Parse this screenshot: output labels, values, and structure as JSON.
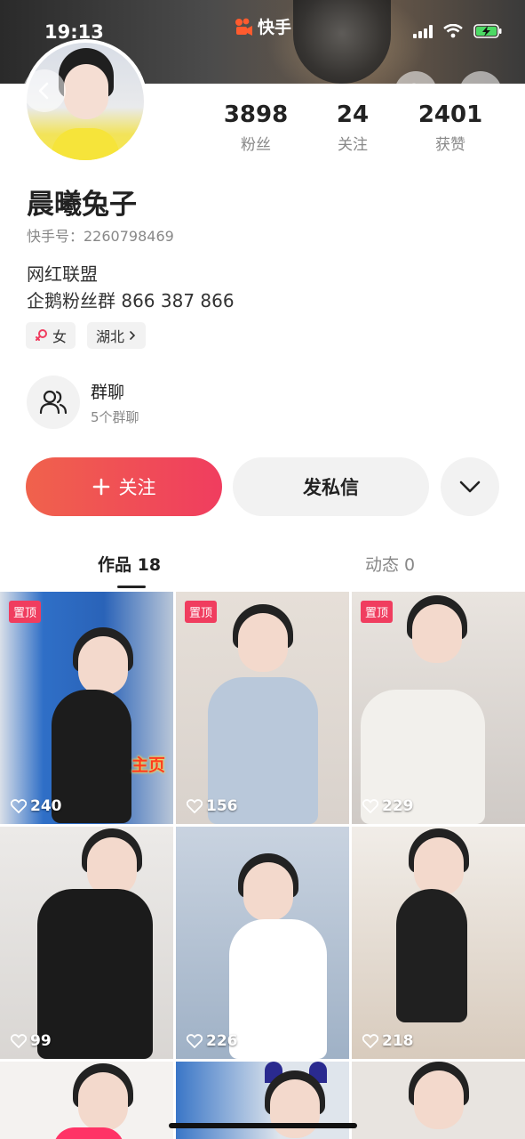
{
  "status_bar": {
    "time": "19:13"
  },
  "app": {
    "name": "快手"
  },
  "profile": {
    "stats": [
      {
        "num": "3898",
        "label": "粉丝"
      },
      {
        "num": "24",
        "label": "关注"
      },
      {
        "num": "2401",
        "label": "获赞"
      }
    ],
    "name": "晨曦兔子",
    "kuaishou_id": "快手号：2260798469",
    "bio_line1": "网红联盟",
    "bio_line2": "企鹅粉丝群 866 387 866",
    "gender_tag": "女",
    "location_tag": "湖北"
  },
  "group": {
    "title": "群聊",
    "subtitle": "5个群聊"
  },
  "actions": {
    "follow": "关注",
    "message": "发私信"
  },
  "tabs": [
    {
      "label": "作品 18"
    },
    {
      "label": "动态 0"
    }
  ],
  "grid": [
    {
      "pinned": "置顶",
      "likes": "240",
      "overlay": "主页"
    },
    {
      "pinned": "置顶",
      "likes": "156"
    },
    {
      "pinned": "置顶",
      "likes": "229"
    },
    {
      "likes": "99"
    },
    {
      "likes": "226"
    },
    {
      "likes": "218"
    }
  ],
  "colors": {
    "accent": "#f03d5f",
    "accent_start": "#f0624c",
    "pin": "#f03d5f"
  }
}
